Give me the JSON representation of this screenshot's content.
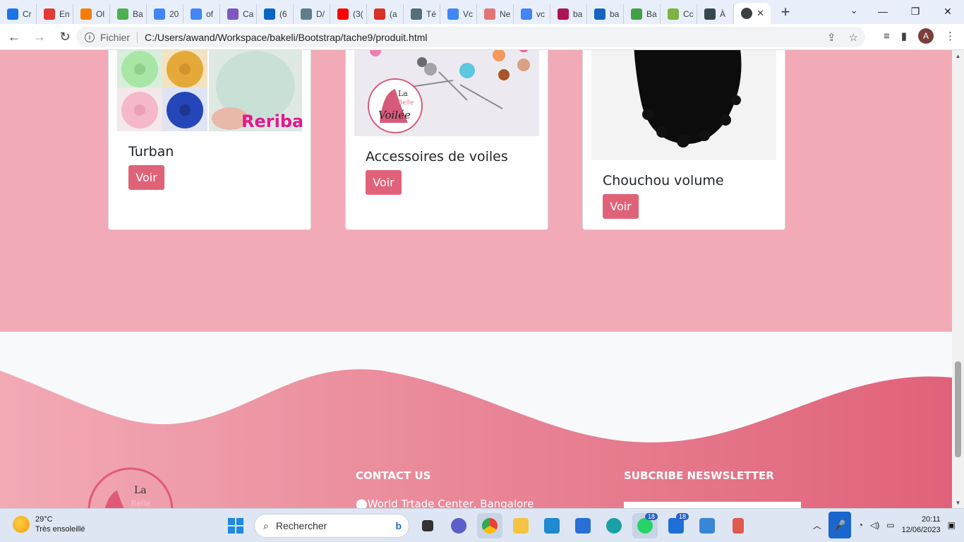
{
  "browser": {
    "tabs": [
      {
        "label": "Cr",
        "color": "#1a73e8"
      },
      {
        "label": "En",
        "color": "#e53935"
      },
      {
        "label": "Ol",
        "color": "#f57c00"
      },
      {
        "label": "Ba",
        "color": "#4caf50"
      },
      {
        "label": "20",
        "color": "#4285f4"
      },
      {
        "label": "of",
        "color": "#4285f4"
      },
      {
        "label": "Ca",
        "color": "#7e57c2"
      },
      {
        "label": "(6",
        "color": "#0a66c2"
      },
      {
        "label": "D/",
        "color": "#607d8b"
      },
      {
        "label": "(3(",
        "color": "#ff0000"
      },
      {
        "label": "(a",
        "color": "#d93025"
      },
      {
        "label": "Té",
        "color": "#546e7a"
      },
      {
        "label": "Vc",
        "color": "#4285f4"
      },
      {
        "label": "Ne",
        "color": "#e57373"
      },
      {
        "label": "vc",
        "color": "#4285f4"
      },
      {
        "label": "ba",
        "color": "#ad1457"
      },
      {
        "label": "ba",
        "color": "#1565c0"
      },
      {
        "label": "Ba",
        "color": "#43a047"
      },
      {
        "label": "Cc",
        "color": "#7cb342"
      },
      {
        "label": "À",
        "color": "#37474f"
      }
    ],
    "active_tab_close": "✕",
    "new_tab": "+",
    "tab_search": "⌄",
    "window_controls": [
      "—",
      "❐",
      "✕"
    ],
    "nav": {
      "back": "←",
      "forward": "→",
      "reload": "↻"
    },
    "address": {
      "scheme_label": "Fichier",
      "url": "C:/Users/awand/Workspace/bakeli/Bootstrap/tache9/produit.html"
    },
    "profile_initial": "A"
  },
  "products": [
    {
      "title": "Turban",
      "button": "Voir"
    },
    {
      "title": "Accessoires de voiles",
      "button": "Voir"
    },
    {
      "title": "Chouchou volume",
      "button": "Voir"
    }
  ],
  "logo_text": {
    "la": "La",
    "belle": "Belle",
    "voilee": "Voilée"
  },
  "footer": {
    "contact_heading": "CONTACT US",
    "address": "World Trtade Center, Bangalore",
    "newsletter_heading": "SUBCRIBE NESWSLETTER"
  },
  "taskbar": {
    "weather_temp": "29°C",
    "weather_desc": "Très ensoleillé",
    "search_placeholder": "Rechercher",
    "whatsapp_badge": "18",
    "mail_badge": "18",
    "time": "20:11",
    "date": "12/06/2023"
  },
  "colors": {
    "pink_bg": "#f1aab6",
    "button": "#e06279",
    "wave_start": "#f2aab5",
    "wave_end": "#e0627a"
  }
}
